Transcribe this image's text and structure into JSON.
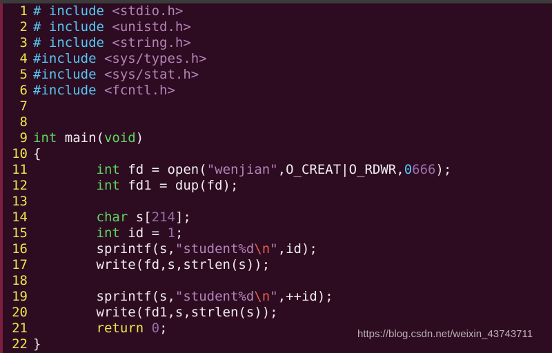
{
  "editor": {
    "background_color": "#2d0c22",
    "top_strip_color": "#3b3b3b",
    "left_strip_color": "#7c1f3e",
    "language": "C",
    "line_count": 22,
    "colors": {
      "line_number": "#e8e84a",
      "preprocessor": "#56c8f2",
      "header_name": "#b583b8",
      "type_keyword": "#5fd75f",
      "control_keyword": "#e8e84a",
      "string": "#b583b8",
      "escape": "#e0604a",
      "number": "#9a6ea8",
      "number_prefix": "#56c8f2",
      "plain_text": "#f0ecee"
    }
  },
  "lines": [
    {
      "n": "1",
      "tokens": [
        {
          "t": "# include ",
          "c": "pp"
        },
        {
          "t": "<stdio.h>",
          "c": "header"
        }
      ]
    },
    {
      "n": "2",
      "tokens": [
        {
          "t": "# include ",
          "c": "pp"
        },
        {
          "t": "<unistd.h>",
          "c": "header"
        }
      ]
    },
    {
      "n": "3",
      "tokens": [
        {
          "t": "# include ",
          "c": "pp"
        },
        {
          "t": "<string.h>",
          "c": "header"
        }
      ]
    },
    {
      "n": "4",
      "tokens": [
        {
          "t": "#include ",
          "c": "pp"
        },
        {
          "t": "<sys/types.h>",
          "c": "header"
        }
      ]
    },
    {
      "n": "5",
      "tokens": [
        {
          "t": "#include ",
          "c": "pp"
        },
        {
          "t": "<sys/stat.h>",
          "c": "header"
        }
      ]
    },
    {
      "n": "6",
      "tokens": [
        {
          "t": "#include ",
          "c": "pp"
        },
        {
          "t": "<fcntl.h>",
          "c": "header"
        }
      ]
    },
    {
      "n": "7",
      "tokens": []
    },
    {
      "n": "8",
      "tokens": []
    },
    {
      "n": "9",
      "tokens": [
        {
          "t": "int",
          "c": "type"
        },
        {
          "t": " main(",
          "c": "plain"
        },
        {
          "t": "void",
          "c": "type"
        },
        {
          "t": ")",
          "c": "plain"
        }
      ]
    },
    {
      "n": "10",
      "tokens": [
        {
          "t": "{",
          "c": "plain"
        }
      ]
    },
    {
      "n": "11",
      "tokens": [
        {
          "t": "        ",
          "c": "plain"
        },
        {
          "t": "int",
          "c": "type"
        },
        {
          "t": " fd = open(",
          "c": "plain"
        },
        {
          "t": "\"wenjian\"",
          "c": "string"
        },
        {
          "t": ",",
          "c": "plain"
        },
        {
          "t": "O_CREAT|O_RDWR",
          "c": "macro"
        },
        {
          "t": ",",
          "c": "plain"
        },
        {
          "t": "0",
          "c": "numpfx"
        },
        {
          "t": "666",
          "c": "num"
        },
        {
          "t": ");",
          "c": "plain"
        }
      ]
    },
    {
      "n": "12",
      "tokens": [
        {
          "t": "        ",
          "c": "plain"
        },
        {
          "t": "int",
          "c": "type"
        },
        {
          "t": " fd1 = dup(fd);",
          "c": "plain"
        }
      ]
    },
    {
      "n": "13",
      "tokens": []
    },
    {
      "n": "14",
      "tokens": [
        {
          "t": "        ",
          "c": "plain"
        },
        {
          "t": "char",
          "c": "type"
        },
        {
          "t": " s[",
          "c": "plain"
        },
        {
          "t": "214",
          "c": "num"
        },
        {
          "t": "];",
          "c": "plain"
        }
      ]
    },
    {
      "n": "15",
      "tokens": [
        {
          "t": "        ",
          "c": "plain"
        },
        {
          "t": "int",
          "c": "type"
        },
        {
          "t": " id = ",
          "c": "plain"
        },
        {
          "t": "1",
          "c": "num"
        },
        {
          "t": ";",
          "c": "plain"
        }
      ]
    },
    {
      "n": "16",
      "tokens": [
        {
          "t": "        sprintf(s,",
          "c": "plain"
        },
        {
          "t": "\"student%d",
          "c": "string"
        },
        {
          "t": "\\n",
          "c": "escape"
        },
        {
          "t": "\"",
          "c": "string"
        },
        {
          "t": ",id);",
          "c": "plain"
        }
      ]
    },
    {
      "n": "17",
      "tokens": [
        {
          "t": "        write(fd,s,strlen(s));",
          "c": "plain"
        }
      ]
    },
    {
      "n": "18",
      "tokens": []
    },
    {
      "n": "19",
      "tokens": [
        {
          "t": "        sprintf(s,",
          "c": "plain"
        },
        {
          "t": "\"student%d",
          "c": "string"
        },
        {
          "t": "\\n",
          "c": "escape"
        },
        {
          "t": "\"",
          "c": "string"
        },
        {
          "t": ",++id);",
          "c": "plain"
        }
      ]
    },
    {
      "n": "20",
      "tokens": [
        {
          "t": "        write(fd1,s,strlen(s));",
          "c": "plain"
        }
      ]
    },
    {
      "n": "21",
      "tokens": [
        {
          "t": "        ",
          "c": "plain"
        },
        {
          "t": "return",
          "c": "kw"
        },
        {
          "t": " ",
          "c": "plain"
        },
        {
          "t": "0",
          "c": "num"
        },
        {
          "t": ";",
          "c": "plain"
        }
      ]
    },
    {
      "n": "22",
      "tokens": [
        {
          "t": "}",
          "c": "plain"
        }
      ]
    }
  ],
  "watermark": {
    "text": "https://blog.csdn.net/weixin_43743711"
  }
}
